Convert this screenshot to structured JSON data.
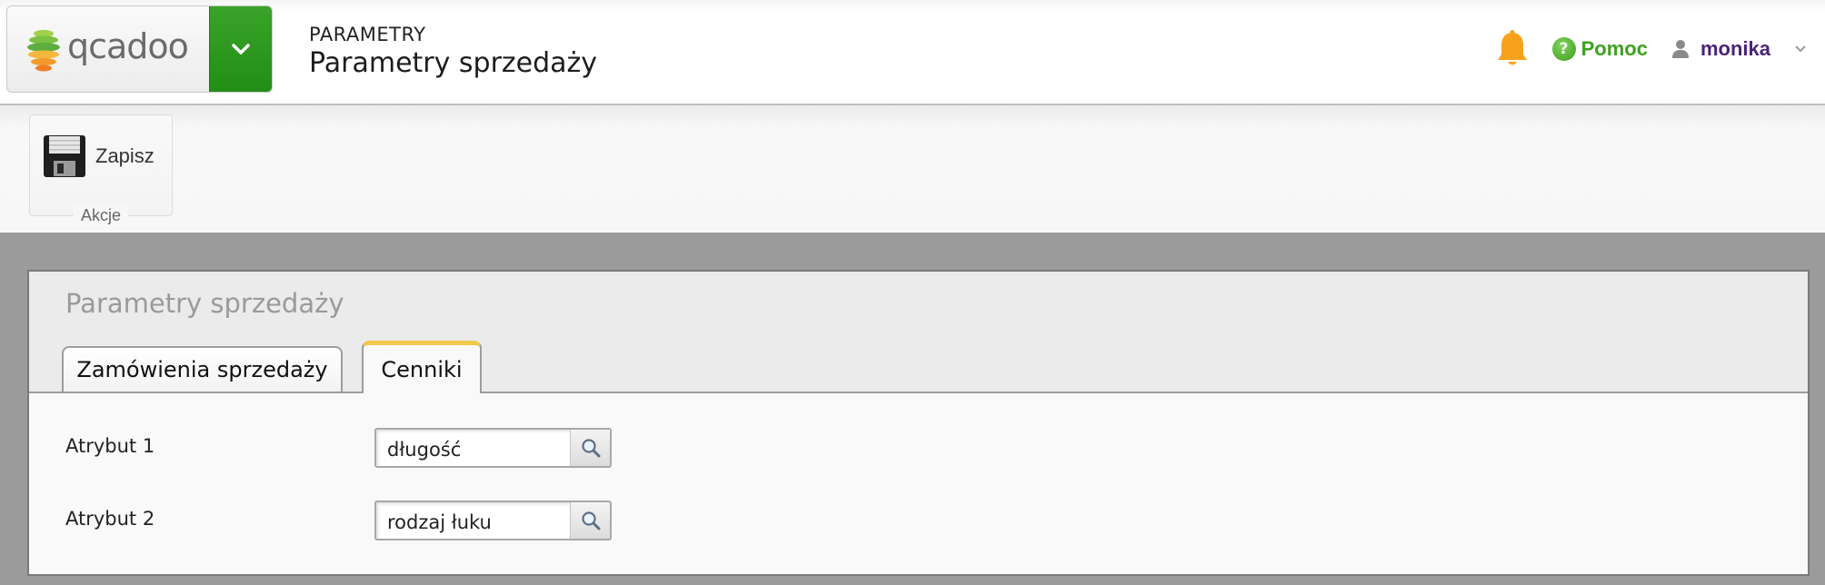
{
  "header": {
    "logo_text": "qcadoo",
    "breadcrumb": "PARAMETRY",
    "title": "Parametry sprzedaży",
    "help_label": "Pomoc",
    "user_name": "monika"
  },
  "toolbar": {
    "save_label": "Zapisz",
    "group_label": "Akcje"
  },
  "panel": {
    "title": "Parametry sprzedaży",
    "tabs": [
      {
        "label": "Zamówienia sprzedaży",
        "active": false
      },
      {
        "label": "Cenniki",
        "active": true
      }
    ],
    "fields": [
      {
        "label": "Atrybut 1",
        "value": "długość"
      },
      {
        "label": "Atrybut 2",
        "value": "rodzaj łuku"
      }
    ]
  },
  "colors": {
    "brand_green": "#2b9a1e",
    "help_green": "#3ea11f",
    "user_purple": "#4b237a",
    "bell_orange": "#f7a21b",
    "active_tab_accent": "#f2c94c",
    "page_background": "#9b9b9b"
  },
  "icons": {
    "logo": "qcadoo-logo-icon",
    "menu": "chevron-down-icon",
    "notifications": "bell-icon",
    "help": "help-circle-icon",
    "user": "user-icon",
    "user_menu": "chevron-down-icon",
    "save": "floppy-disk-icon",
    "lookup": "magnifier-icon"
  }
}
